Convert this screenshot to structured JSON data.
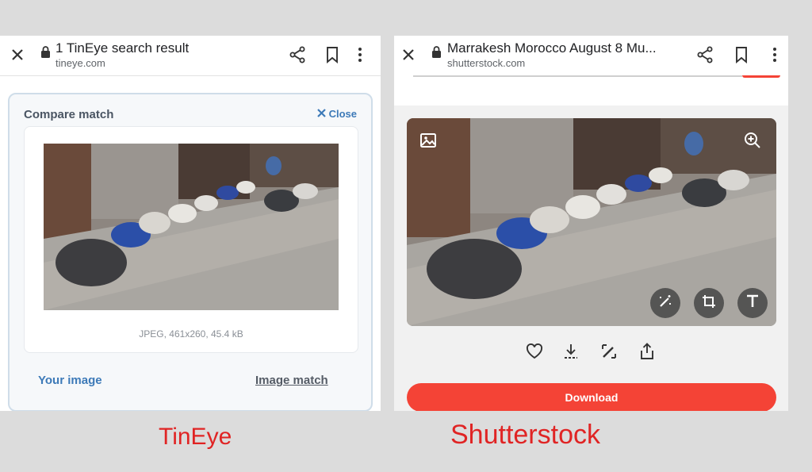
{
  "left": {
    "header": {
      "title": "1 TinEye search result",
      "url": "tineye.com"
    },
    "compare": {
      "heading": "Compare match",
      "close_label": "Close",
      "image_meta": "JPEG, 461x260, 45.4 kB",
      "your_image": "Your image",
      "image_match": "Image match"
    },
    "caption": "TinEye"
  },
  "right": {
    "header": {
      "title": "Marrakesh Morocco August 8 Mu...",
      "url": "shutterstock.com"
    },
    "download_label": "Download",
    "caption": "Shutterstock"
  },
  "colors": {
    "accent_blue": "#3d7ab8",
    "shutterstock_red": "#f44336",
    "caption_red": "#e02424"
  }
}
